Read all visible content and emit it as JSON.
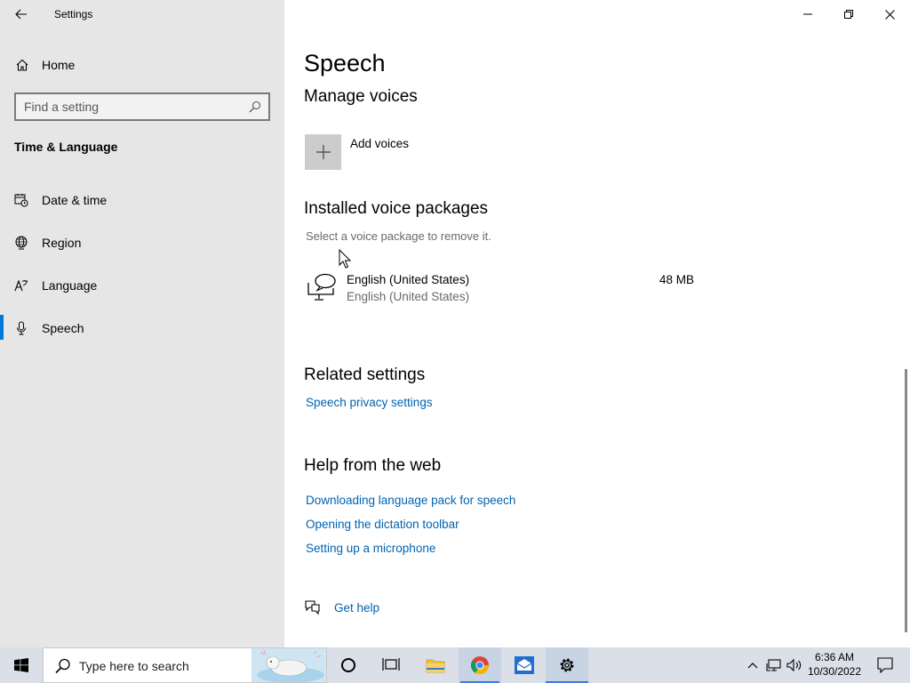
{
  "window": {
    "app_title": "Settings"
  },
  "sidebar": {
    "home_label": "Home",
    "search_placeholder": "Find a setting",
    "section_header": "Time & Language",
    "items": [
      {
        "label": "Date & time",
        "icon": "calendar-clock-icon"
      },
      {
        "label": "Region",
        "icon": "globe-icon"
      },
      {
        "label": "Language",
        "icon": "language-icon"
      },
      {
        "label": "Speech",
        "icon": "microphone-icon",
        "active": true
      }
    ]
  },
  "main": {
    "page_title": "Speech",
    "manage_voices": {
      "heading": "Manage voices",
      "add_label": "Add voices"
    },
    "installed": {
      "heading": "Installed voice packages",
      "subtext": "Select a voice package to remove it.",
      "packages": [
        {
          "name": "English (United States)",
          "sub": "English (United States)",
          "size": "48 MB"
        }
      ]
    },
    "related": {
      "heading": "Related settings",
      "links": [
        "Speech privacy settings"
      ]
    },
    "help": {
      "heading": "Help from the web",
      "links": [
        "Downloading language pack for speech",
        "Opening the dictation toolbar",
        "Setting up a microphone"
      ],
      "get_help": "Get help"
    }
  },
  "taskbar": {
    "search_placeholder": "Type here to search",
    "time": "6:36 AM",
    "date": "10/30/2022",
    "accent": "#0078d7"
  }
}
